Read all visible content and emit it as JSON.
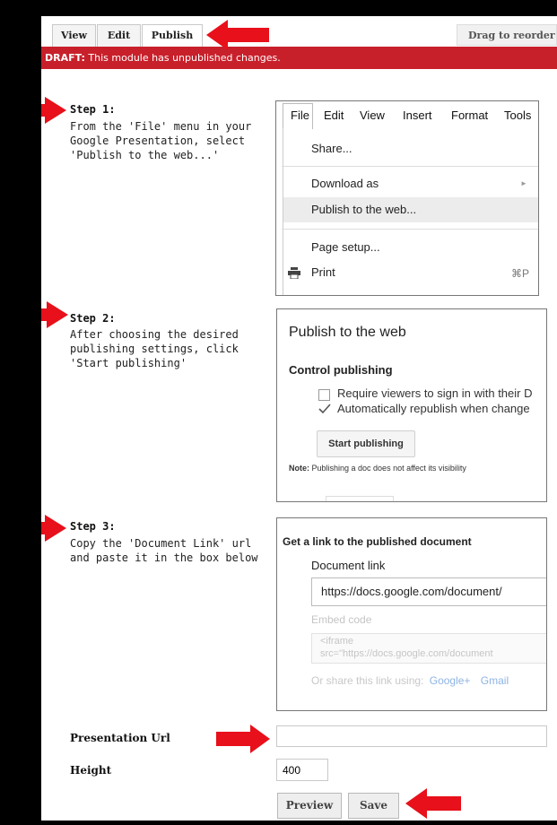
{
  "tabs": {
    "view": "View",
    "edit": "Edit",
    "publish": "Publish",
    "drag": "Drag to reorder"
  },
  "draft": {
    "prefix": "DRAFT:",
    "message": " This module has unpublished changes."
  },
  "steps": [
    {
      "title": "Step 1:",
      "description": "From the 'File' menu in your Google Presentation, select 'Publish to the web...'"
    },
    {
      "title": "Step 2:",
      "description": "After choosing the desired publishing settings, click 'Start publishing'"
    },
    {
      "title": "Step 3:",
      "description": "Copy the 'Document Link' url and paste it in the box below"
    }
  ],
  "menu_shot": {
    "menubar": [
      "File",
      "Edit",
      "View",
      "Insert",
      "Format",
      "Tools"
    ],
    "items": {
      "share": "Share...",
      "download": "Download as",
      "publish": "Publish to the web...",
      "page_setup": "Page setup...",
      "print": "Print",
      "print_shortcut": "⌘P",
      "download_chevron": "►"
    }
  },
  "publish_shot": {
    "title": "Publish to the web",
    "control": "Control publishing",
    "option1": "Require viewers to sign in with their D",
    "option2": "Automatically republish when change",
    "button": "Start publishing",
    "note_label": "Note:",
    "note": " Publishing a doc does not affect its visibility"
  },
  "link_shot": {
    "heading": "Get a link to the published document",
    "doc_link_label": "Document link",
    "doc_link_value": "https://docs.google.com/document/",
    "embed_label": "Embed code",
    "embed_line1": "<iframe",
    "embed_line2": "src=\"https://docs.google.com/document",
    "share_label": "Or share this link using:",
    "share_gplus": "Google+",
    "share_gmail": "Gmail"
  },
  "form": {
    "url_label": "Presentation Url",
    "url_value": "",
    "height_label": "Height",
    "height_value": "400",
    "preview": "Preview",
    "save": "Save"
  },
  "colors": {
    "draft_bar": "#c8202b",
    "arrow": "#e8101a",
    "link_blue": "#6a9bd8"
  }
}
